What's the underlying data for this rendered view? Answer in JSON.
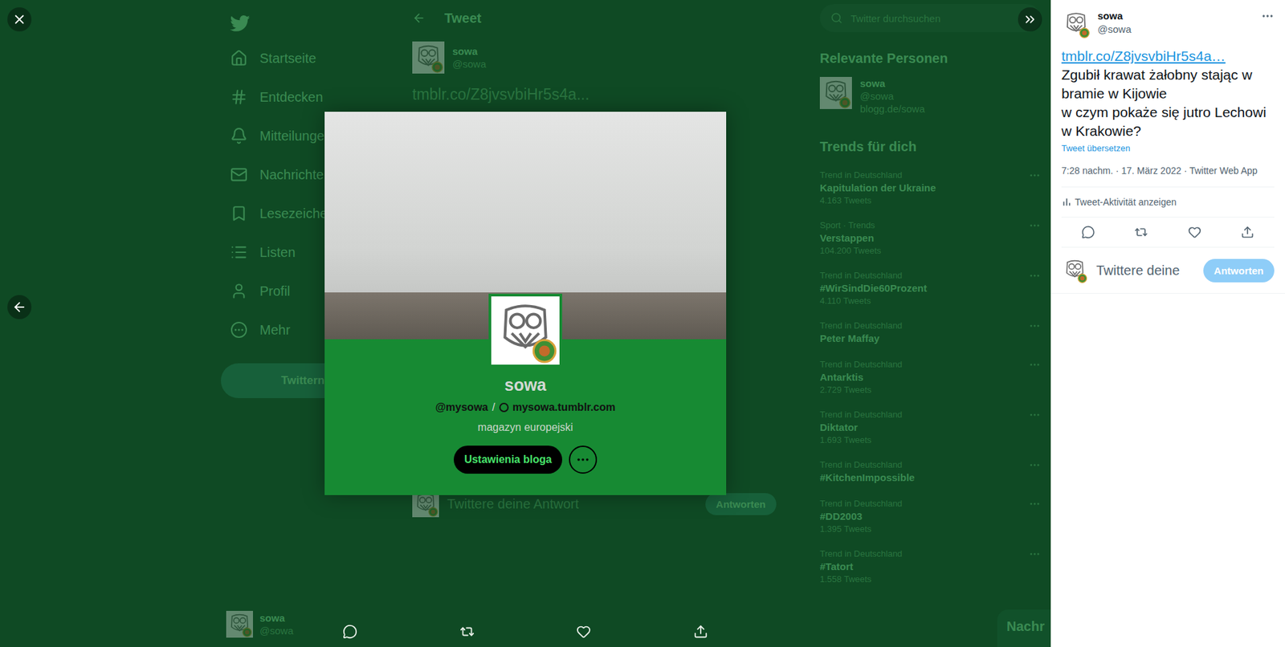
{
  "nav": {
    "items": [
      {
        "label": "Startseite",
        "selected": false
      },
      {
        "label": "Entdecken",
        "selected": false
      },
      {
        "label": "Mitteilunge",
        "selected": false
      },
      {
        "label": "Nachrichte",
        "selected": false
      },
      {
        "label": "Lesezeiche",
        "selected": false
      },
      {
        "label": "Listen",
        "selected": false
      },
      {
        "label": "Profil",
        "selected": false
      },
      {
        "label": "Mehr",
        "selected": false
      }
    ],
    "tweet_button": "Twittern",
    "account": {
      "name": "sowa",
      "handle": "@sowa"
    }
  },
  "main": {
    "title": "Tweet",
    "author": {
      "name": "sowa",
      "handle": "@sowa"
    },
    "link": "tmblr.co/Z8jvsvbiHr5s4a...",
    "reply_placeholder": "Twittere deine Antwort",
    "reply_button": "Antworten"
  },
  "sidebar": {
    "search_placeholder": "Twitter durchsuchen",
    "related_title": "Relevante Personen",
    "related": {
      "name": "sowa",
      "handle": "@sowa",
      "bio": "blogg.de/sowa"
    },
    "trends_title": "Trends für dich",
    "trends": [
      {
        "category": "Trend in Deutschland",
        "title": "Kapitulation der Ukraine",
        "count": "4.163 Tweets"
      },
      {
        "category": "Sport · Trends",
        "title": "Verstappen",
        "count": "104.200 Tweets"
      },
      {
        "category": "Trend in Deutschland",
        "title": "#WirSindDie60Prozent",
        "count": "4.110 Tweets"
      },
      {
        "category": "Trend in Deutschland",
        "title": "Peter Maffay",
        "count": ""
      },
      {
        "category": "Trend in Deutschland",
        "title": "Antarktis",
        "count": "2.729 Tweets"
      },
      {
        "category": "Trend in Deutschland",
        "title": "Diktator",
        "count": "1.693 Tweets"
      },
      {
        "category": "Trend in Deutschland",
        "title": "#KitchenImpossible",
        "count": ""
      },
      {
        "category": "Trend in Deutschland",
        "title": "#DD2003",
        "count": "1.395 Tweets"
      },
      {
        "category": "Trend in Deutschland",
        "title": "#Tatort",
        "count": "1.558 Tweets"
      }
    ]
  },
  "messages_drawer": "Nachr",
  "viewer": {
    "profile": {
      "name": "sowa",
      "handle": "@mysowa",
      "separator": "/",
      "site": "mysowa.tumblr.com",
      "description": "magazyn europejski",
      "settings_button": "Ustawienia bloga"
    }
  },
  "tweet_panel": {
    "author": {
      "name": "sowa",
      "handle": "@sowa"
    },
    "link": "tmblr.co/Z8jvsvbiHr5s4a…",
    "text": "Zgubił krawat żałobny stając w bramie w Kijowie\nw czym pokaże się jutro Lechowi w Krakowie?",
    "translate": "Tweet übersetzen",
    "meta": "7:28 nachm. · 17. März 2022 · Twitter Web App",
    "activity": "Tweet-Aktivität anzeigen",
    "reply_placeholder": "Twittere deine",
    "reply_button": "Antworten",
    "reply_disabled": true
  }
}
